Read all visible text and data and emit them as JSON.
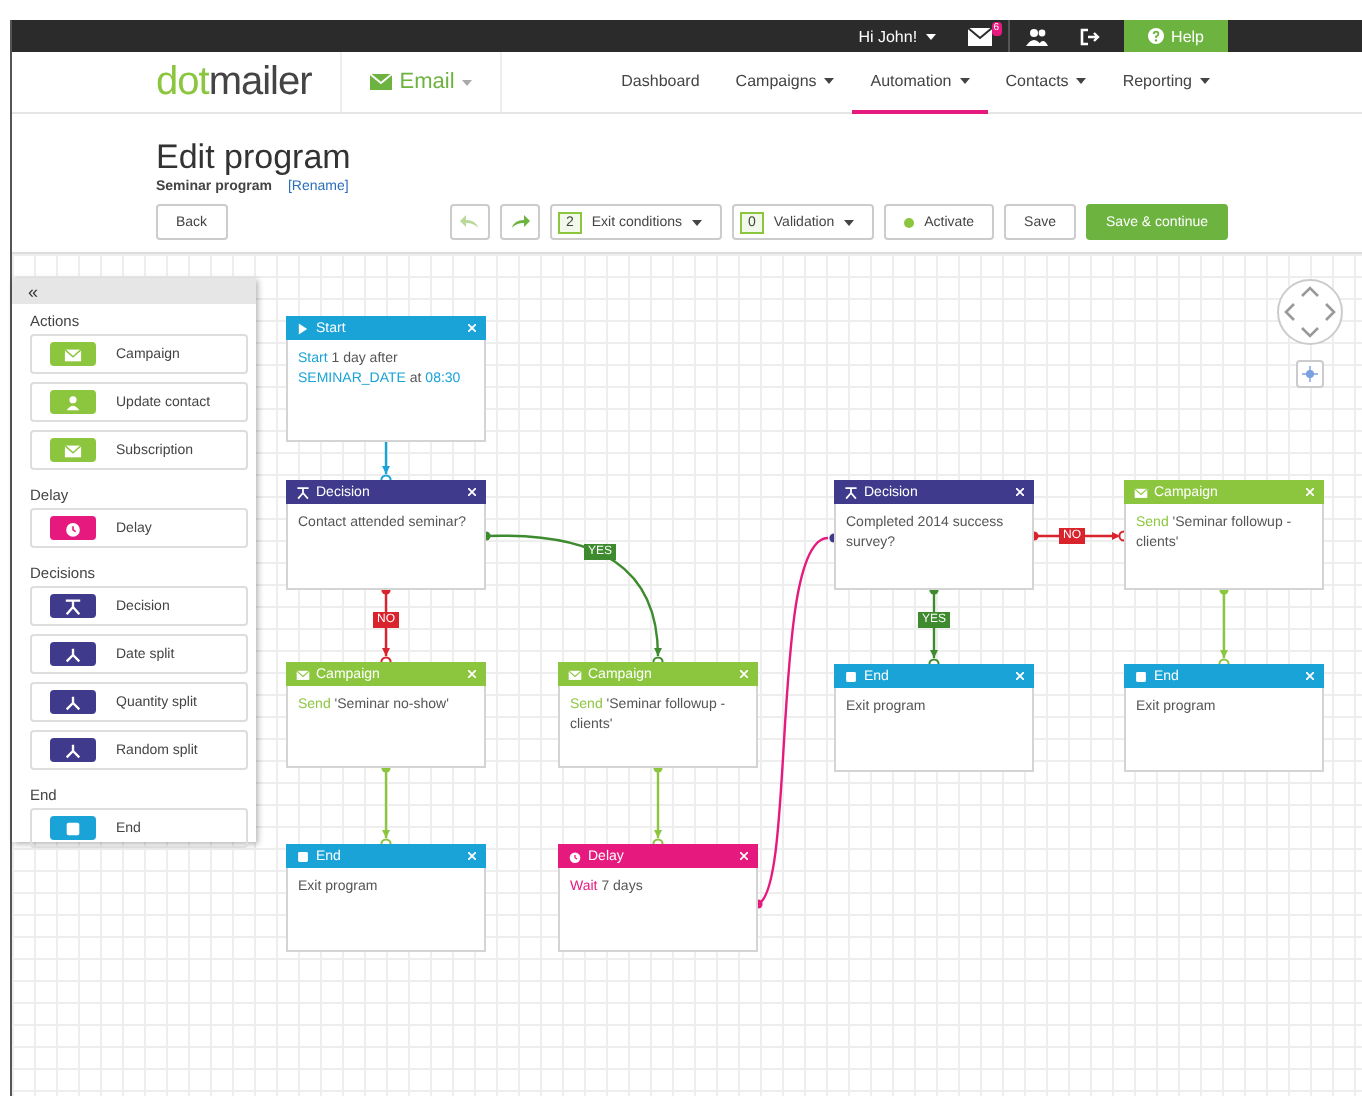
{
  "top_bar": {
    "greeting": "Hi John!",
    "mail_badge": "6",
    "help": "Help"
  },
  "nav": {
    "logo_parts": [
      "dot",
      "mailer"
    ],
    "product": "Email",
    "items": [
      {
        "label": "Dashboard",
        "dropdown": false,
        "selected": false
      },
      {
        "label": "Campaigns",
        "dropdown": true,
        "selected": false
      },
      {
        "label": "Automation",
        "dropdown": true,
        "selected": true
      },
      {
        "label": "Contacts",
        "dropdown": true,
        "selected": false
      },
      {
        "label": "Reporting",
        "dropdown": true,
        "selected": false
      }
    ]
  },
  "header": {
    "title": "Edit program",
    "program_name": "Seminar program",
    "rename": "[Rename]"
  },
  "toolbar": {
    "back": "Back",
    "exit_conditions": {
      "count": "2",
      "label": "Exit conditions"
    },
    "validation": {
      "count": "0",
      "label": "Validation"
    },
    "activate": "Activate",
    "save": "Save",
    "save_continue": "Save & continue"
  },
  "palette": {
    "collapse": "«",
    "groups": [
      {
        "title": "Actions",
        "items": [
          {
            "label": "Campaign",
            "kind": "campaign"
          },
          {
            "label": "Update contact",
            "kind": "contact"
          },
          {
            "label": "Subscription",
            "kind": "subscription"
          }
        ]
      },
      {
        "title": "Delay",
        "items": [
          {
            "label": "Delay",
            "kind": "delay"
          }
        ]
      },
      {
        "title": "Decisions",
        "items": [
          {
            "label": "Decision",
            "kind": "decision"
          },
          {
            "label": "Date split",
            "kind": "split"
          },
          {
            "label": "Quantity split",
            "kind": "split"
          },
          {
            "label": "Random split",
            "kind": "split"
          }
        ]
      },
      {
        "title": "End",
        "items": [
          {
            "label": "End",
            "kind": "end"
          }
        ]
      }
    ]
  },
  "nodes": [
    {
      "kind": "start",
      "title": "Start",
      "body": [
        {
          "text": "Start",
          "highlight": true
        },
        {
          "text": " 1 day after ",
          "highlight": false
        },
        {
          "text": "SEMINAR_DATE",
          "highlight": true
        },
        {
          "text": " at ",
          "highlight": false
        },
        {
          "text": "08:30",
          "highlight": true
        }
      ]
    },
    {
      "kind": "decision",
      "title": "Decision",
      "body": [
        {
          "text": "Contact attended seminar?",
          "highlight": false
        }
      ]
    },
    {
      "kind": "campaign",
      "title": "Campaign",
      "body": [
        {
          "text": "Send",
          "highlight": true
        },
        {
          "text": " 'Seminar no-show'",
          "highlight": false
        }
      ]
    },
    {
      "kind": "end",
      "title": "End",
      "body": [
        {
          "text": "Exit program",
          "highlight": false
        }
      ]
    },
    {
      "kind": "campaign",
      "title": "Campaign",
      "body": [
        {
          "text": "Send",
          "highlight": true
        },
        {
          "text": " 'Seminar followup - clients'",
          "highlight": false
        }
      ]
    },
    {
      "kind": "delay",
      "title": "Delay",
      "body": [
        {
          "text": "Wait",
          "highlight": true
        },
        {
          "text": " 7 days",
          "highlight": false
        }
      ]
    },
    {
      "kind": "decision",
      "title": "Decision",
      "body": [
        {
          "text": "Completed 2014 success survey?",
          "highlight": false
        }
      ]
    },
    {
      "kind": "campaign",
      "title": "Campaign",
      "body": [
        {
          "text": "Send",
          "highlight": true
        },
        {
          "text": " 'Seminar followup - clients'",
          "highlight": false
        }
      ]
    },
    {
      "kind": "end",
      "title": "End",
      "body": [
        {
          "text": "Exit program",
          "highlight": false
        }
      ]
    },
    {
      "kind": "end",
      "title": "End",
      "body": [
        {
          "text": "Exit program",
          "highlight": false
        }
      ]
    }
  ],
  "connectors": [
    {
      "kind": "start"
    },
    {
      "kind": "no",
      "label": "NO"
    },
    {
      "kind": "yes",
      "label": "YES"
    },
    {
      "kind": "campaign"
    },
    {
      "kind": "campaign"
    },
    {
      "kind": "delay"
    },
    {
      "kind": "no",
      "label": "NO"
    },
    {
      "kind": "yes",
      "label": "YES"
    },
    {
      "kind": "campaign"
    }
  ]
}
